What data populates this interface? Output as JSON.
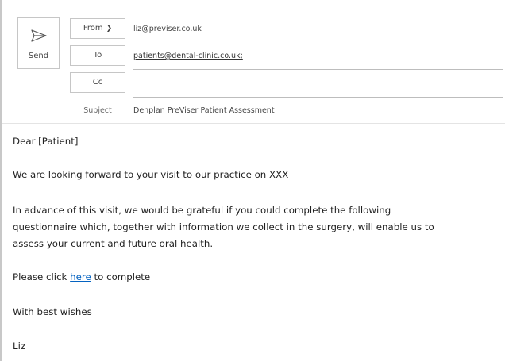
{
  "compose": {
    "send_label": "Send",
    "from_label": "From",
    "from_value": "liz@previser.co.uk",
    "to_label": "To",
    "to_value": "patients@dental-clinic.co.uk;",
    "cc_label": "Cc",
    "cc_value": "",
    "subject_label": "Subject",
    "subject_value": "Denplan PreViser Patient Assessment"
  },
  "body": {
    "greeting": "Dear [Patient]",
    "line1": "We are looking forward to your visit to our practice on XXX",
    "line2_part1": "In advance of this visit, we would be grateful if you could complete the following",
    "line2_part2": "questionnaire which, together with information we collect in the surgery, will enable us to",
    "line2_part3": "assess your current and future oral health.",
    "click_prefix": "Please click ",
    "click_link": "here",
    "click_suffix": " to complete",
    "signoff": "With best wishes",
    "signature": "Liz"
  }
}
